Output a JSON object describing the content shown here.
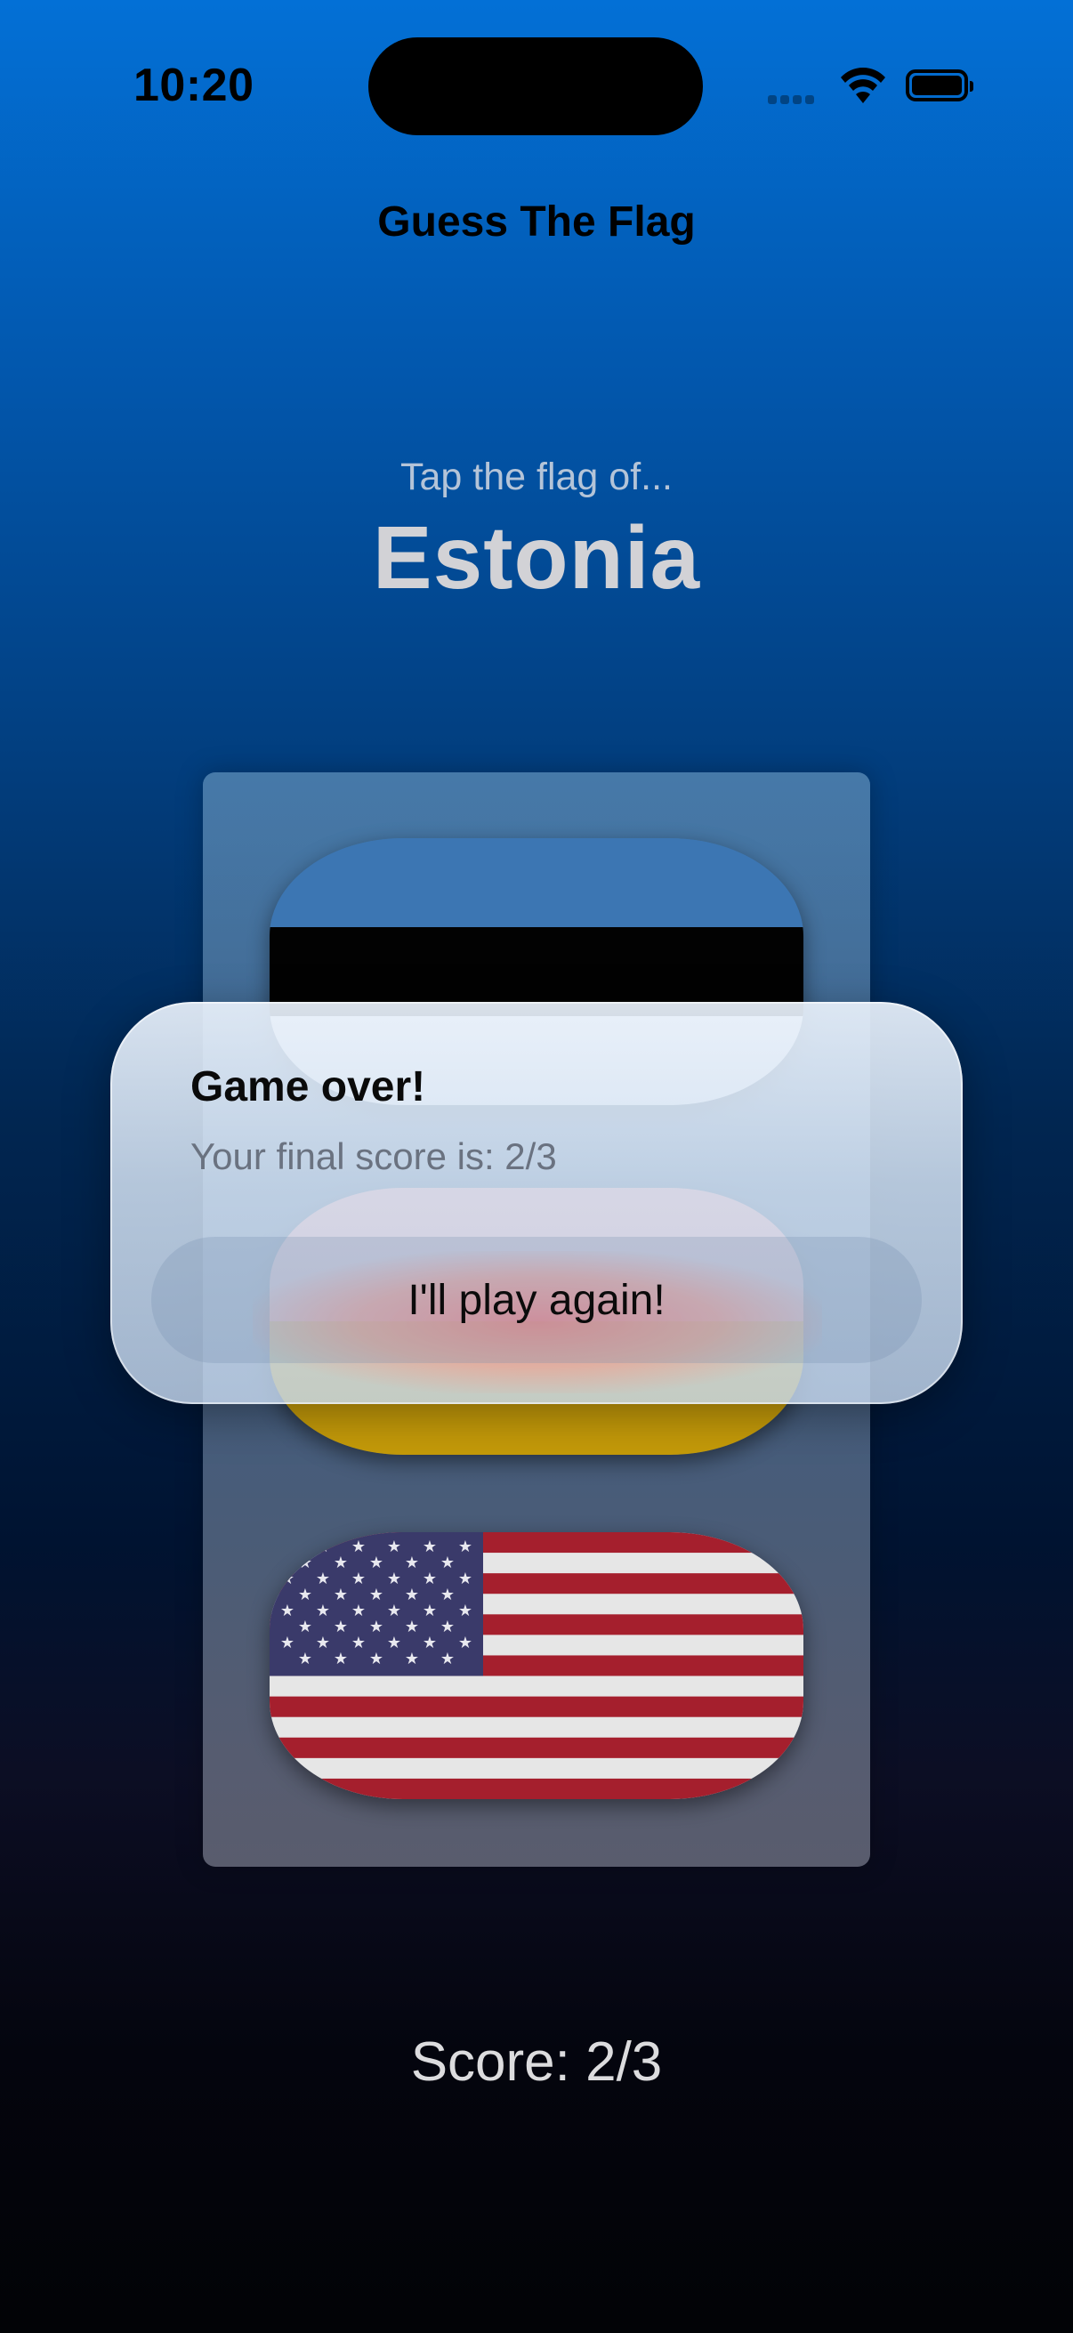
{
  "status_bar": {
    "time": "10:20"
  },
  "navigation": {
    "title": "Guess The Flag"
  },
  "question": {
    "prompt": "Tap the flag of...",
    "country": "Estonia"
  },
  "flags": [
    {
      "country": "Estonia",
      "colors": [
        "#3c76b3",
        "#020202",
        "#f2f2f2"
      ]
    },
    {
      "country": "",
      "colors": [
        "#f39a9a",
        "#c49a09"
      ]
    },
    {
      "country": "United States",
      "colors": [
        "#b22234",
        "#ffffff",
        "#3c3b6e"
      ]
    }
  ],
  "alert": {
    "title": "Game over!",
    "message": "Your final score is: 2/3",
    "button_label": "I'll play again!"
  },
  "score": {
    "label": "Score: 2/3"
  },
  "colors": {
    "accent_top": "#0370d6",
    "accent_bottom": "#020306"
  }
}
